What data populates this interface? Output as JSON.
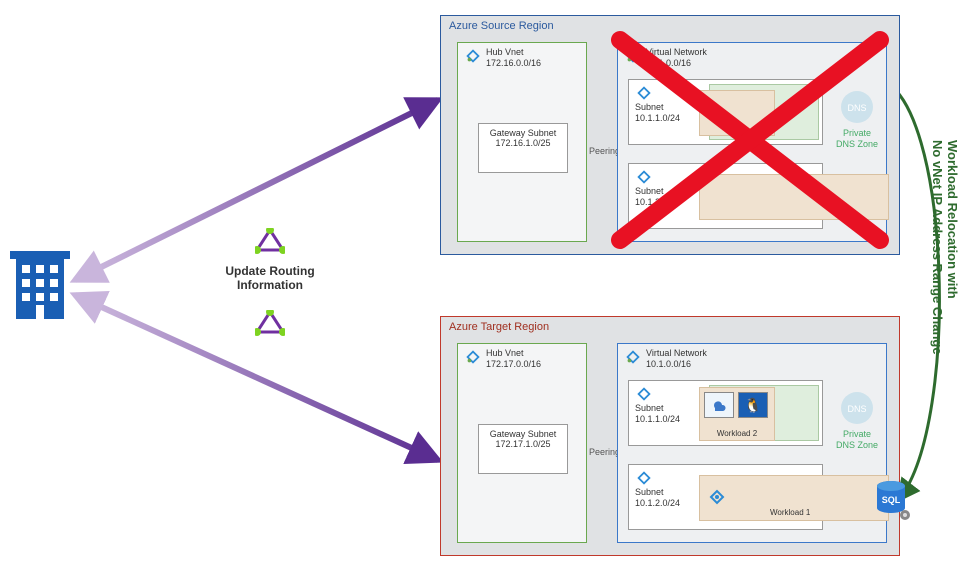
{
  "source_region": {
    "title": "Azure Source Region",
    "hub": {
      "title": "Hub Vnet",
      "cidr": "172.16.0.0/16",
      "gateway": {
        "title": "Gateway Subnet",
        "cidr": "172.16.1.0/25"
      }
    },
    "vnet": {
      "title": "Virtual Network",
      "cidr": "10.1.0.0/16",
      "subnet1": {
        "title": "Subnet",
        "cidr": "10.1.1.0/24"
      },
      "subnet2": {
        "title": "Subnet",
        "cidr": "10.1.2.0/24"
      },
      "dns": {
        "line1": "Private",
        "line2": "DNS Zone"
      }
    },
    "peering": "Peering"
  },
  "target_region": {
    "title": "Azure Target Region",
    "hub": {
      "title": "Hub Vnet",
      "cidr": "172.17.0.0/16",
      "gateway": {
        "title": "Gateway Subnet",
        "cidr": "172.17.1.0/25"
      }
    },
    "vnet": {
      "title": "Virtual Network",
      "cidr": "10.1.0.0/16",
      "subnet1": {
        "title": "Subnet",
        "cidr": "10.1.1.0/24",
        "workload": "Workload 2"
      },
      "subnet2": {
        "title": "Subnet",
        "cidr": "10.1.2.0/24",
        "workload": "Workload 1"
      },
      "dns": {
        "line1": "Private",
        "line2": "DNS Zone"
      }
    },
    "peering": "Peering"
  },
  "routing_label": {
    "line1": "Update Routing",
    "line2": "Information"
  },
  "relocation_label": {
    "line1": "Workload Relocation with",
    "line2": "No vNet IP Address Range Change"
  },
  "sql_label": "SQL"
}
